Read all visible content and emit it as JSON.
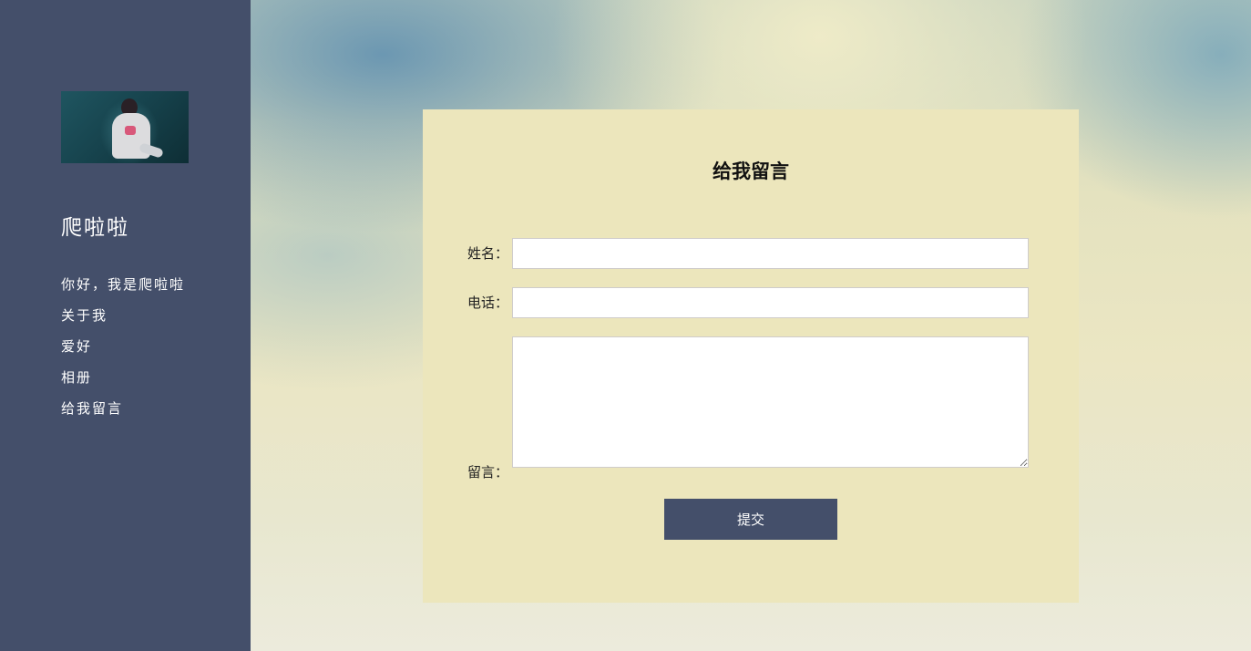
{
  "sidebar": {
    "site_title": "爬啦啦",
    "nav_items": [
      {
        "label": "你好，我是爬啦啦"
      },
      {
        "label": "关于我"
      },
      {
        "label": "爱好"
      },
      {
        "label": "相册"
      },
      {
        "label": "给我留言"
      }
    ],
    "colors": {
      "background": "#444f6a",
      "text": "#ffffff"
    }
  },
  "form": {
    "title": "给我留言",
    "name_label": "姓名：",
    "name_value": "",
    "phone_label": "电话：",
    "phone_value": "",
    "message_label": "留言：",
    "message_value": "",
    "submit_label": "提交",
    "colors": {
      "card_background": "#ece6bc",
      "button": "#444f6a"
    }
  }
}
